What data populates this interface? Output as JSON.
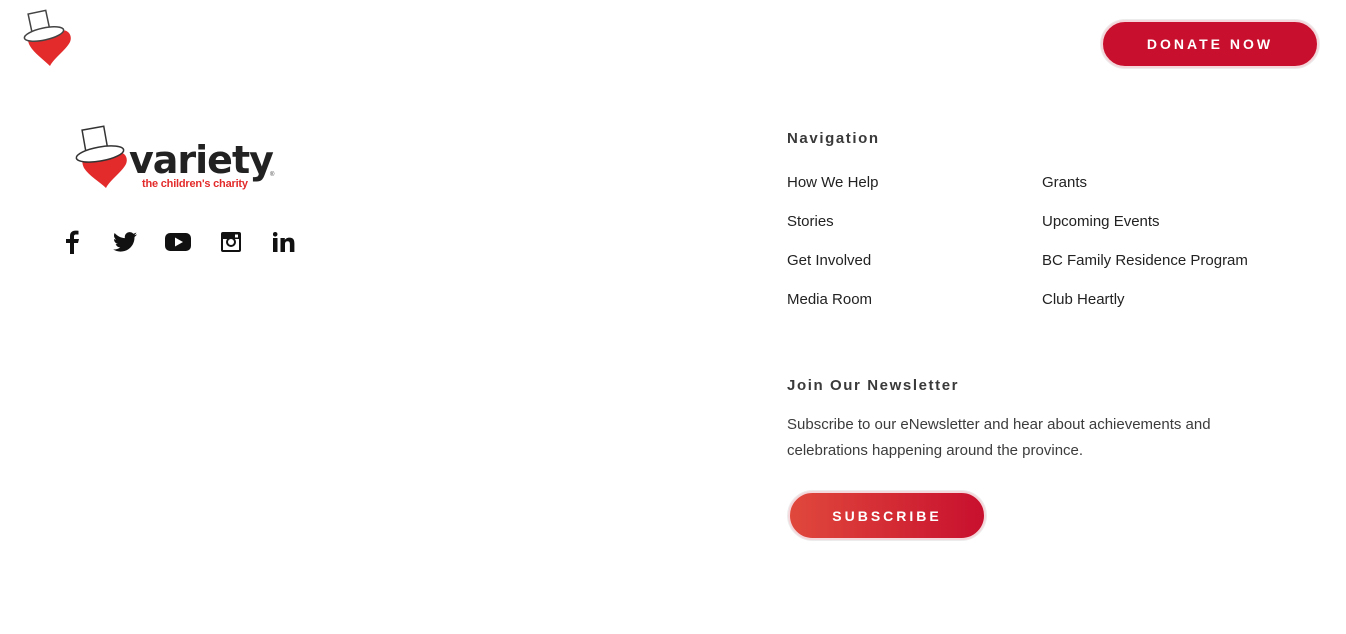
{
  "header": {
    "logo_icon": "tophat-heart-logo",
    "donate_label": "DONATE NOW"
  },
  "brand": {
    "wordmark": "variety",
    "tagline": "the children's charity",
    "registered": "®"
  },
  "social": [
    {
      "icon": "facebook-icon"
    },
    {
      "icon": "twitter-icon"
    },
    {
      "icon": "youtube-icon"
    },
    {
      "icon": "instagram-icon"
    },
    {
      "icon": "linkedin-icon"
    }
  ],
  "navigation": {
    "title": "Navigation",
    "items": [
      {
        "label": "How We Help"
      },
      {
        "label": "Grants"
      },
      {
        "label": "Stories"
      },
      {
        "label": "Upcoming Events"
      },
      {
        "label": "Get Involved"
      },
      {
        "label": "BC Family Residence Program"
      },
      {
        "label": "Media Room"
      },
      {
        "label": "Club Heartly"
      }
    ]
  },
  "newsletter": {
    "title": "Join Our Newsletter",
    "description": "Subscribe to our eNewsletter and hear about achievements and celebrations happening around the province.",
    "button_label": "SUBSCRIBE"
  },
  "colors": {
    "brand_red": "#c8102e",
    "heart_red": "#e32b2b",
    "text_dark": "#222222"
  }
}
